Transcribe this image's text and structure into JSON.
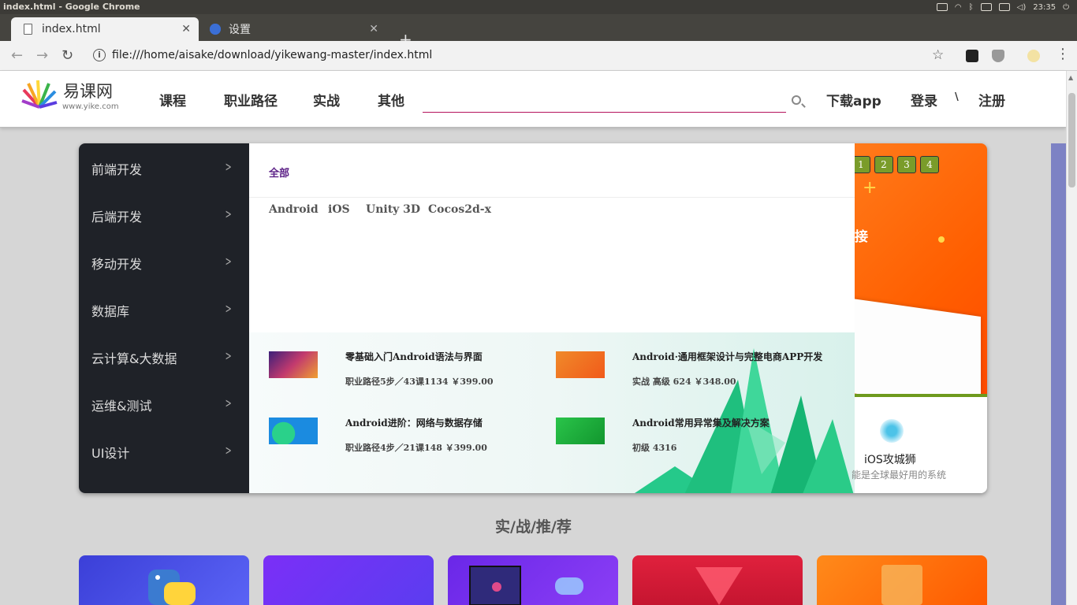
{
  "os": {
    "window_title": "index.html - Google Chrome",
    "time": "23:35"
  },
  "browser": {
    "tabs": [
      {
        "label": "index.html",
        "active": true
      },
      {
        "label": "设置",
        "active": false
      }
    ],
    "url": "file:///home/aisake/download/yikewang-master/index.html"
  },
  "site": {
    "logo": {
      "name": "易课网",
      "domain": "www.yike.com"
    },
    "nav": [
      "课程",
      "职业路径",
      "实战",
      "其他"
    ],
    "search": {
      "placeholder": ""
    },
    "links": {
      "download": "下载app",
      "login": "登录",
      "sep": "\\",
      "register": "注册"
    }
  },
  "categories": [
    "前端开发",
    "后端开发",
    "移动开发",
    "数据库",
    "云计算&大数据",
    "运维&测试",
    "UI设计"
  ],
  "subpanel": {
    "all_label": "全部",
    "tags": [
      "Android",
      "iOS",
      "Unity 3D",
      "Cocos2d-x"
    ],
    "courses": [
      {
        "title": "零基础入门Android语法与界面",
        "meta": "职业路径5步／43课1134 ￥399.00",
        "thumb_color": "#6b2fa3"
      },
      {
        "title": "Android·通用框架设计与完整电商APP开发",
        "meta": "实战 高级 624 ￥348.00",
        "thumb_color": "#f4731d"
      },
      {
        "title": "Android进阶：网络与数据存储",
        "meta": "职业路径4步／21课148 ￥399.00",
        "thumb_color": "#1d8fd6"
      },
      {
        "title": "Android常用异常集及解决方案",
        "meta": "初级 4316",
        "thumb_color": "#1fae3c"
      }
    ]
  },
  "slider": {
    "dots": [
      "1",
      "2",
      "3",
      "4"
    ],
    "partial_text": "接"
  },
  "promo": {
    "title": "iOS攻城狮",
    "subtitle": "能是全球最好用的系统"
  },
  "section": {
    "title": "实/战/推/荐"
  },
  "colors": {
    "brand_accent": "#b5135c",
    "sidebar_bg": "#1f2228",
    "rec_cards": [
      "#4a4df0",
      "#7a2ff5",
      "#6a27e8",
      "#d61e3b",
      "#ff6a10"
    ]
  }
}
